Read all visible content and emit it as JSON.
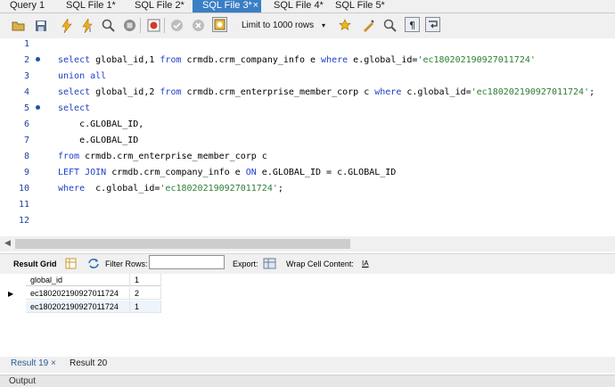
{
  "tabs": [
    {
      "label": "Query 1"
    },
    {
      "label": "SQL File 1*"
    },
    {
      "label": "SQL File 2*"
    },
    {
      "label": "SQL File 3*",
      "active": true,
      "close": "×"
    },
    {
      "label": "SQL File 4*"
    },
    {
      "label": "SQL File 5*"
    }
  ],
  "toolbar": {
    "limit_label": "Limit to 1000 rows",
    "limit_caret": "▾"
  },
  "editor": {
    "line_numbers": [
      "1",
      "2",
      "3",
      "4",
      "5",
      "6",
      "7",
      "8",
      "9",
      "10",
      "11",
      "12"
    ],
    "lines": {
      "l2": {
        "a": "select",
        "b": " global_id,1 ",
        "c": "from",
        "d": " crmdb.crm_company_info e ",
        "e": "where",
        "f": " e.global_id=",
        "g": "'ec180202190927011724'"
      },
      "l3": {
        "a": "union all"
      },
      "l4": {
        "a": "select",
        "b": " global_id,2 ",
        "c": "from",
        "d": " crmdb.crm_enterprise_member_corp c ",
        "e": "where",
        "f": " c.global_id=",
        "g": "'ec180202190927011724'",
        "h": ";"
      },
      "l5": {
        "a": "select"
      },
      "l6": {
        "a": "    c.GLOBAL_ID,"
      },
      "l7": {
        "a": "    e.GLOBAL_ID"
      },
      "l8": {
        "a": "from",
        "b": " crmdb.crm_enterprise_member_corp c"
      },
      "l9": {
        "a": "LEFT JOIN",
        "b": " crmdb.crm_company_info e ",
        "c": "ON",
        "d": " e.GLOBAL_ID = c.GLOBAL_ID"
      },
      "l10": {
        "a": "where",
        "b": "  c.global_id=",
        "c": "'ec180202190927011724'",
        "d": ";"
      }
    }
  },
  "result_toolbar": {
    "result_grid_label": "Result Grid",
    "filter_rows_label": "Filter Rows:",
    "export_label": "Export:",
    "wrap_label": "Wrap Cell Content:",
    "wrap_icon": "IA"
  },
  "grid": {
    "columns": [
      "global_id",
      "1"
    ],
    "rows": [
      {
        "global_id": "ec180202190927011724",
        "val": "2"
      },
      {
        "global_id": "ec180202190927011724",
        "val": "1"
      }
    ],
    "row_marker": "▶"
  },
  "bottom_tabs": [
    {
      "label": "Result 19",
      "close": "×"
    },
    {
      "label": "Result 20"
    }
  ],
  "output_label": "Output",
  "colors": {
    "keyword": "#1f3fc9",
    "string": "#2e7d32",
    "active_tab": "#3a7fc4"
  }
}
